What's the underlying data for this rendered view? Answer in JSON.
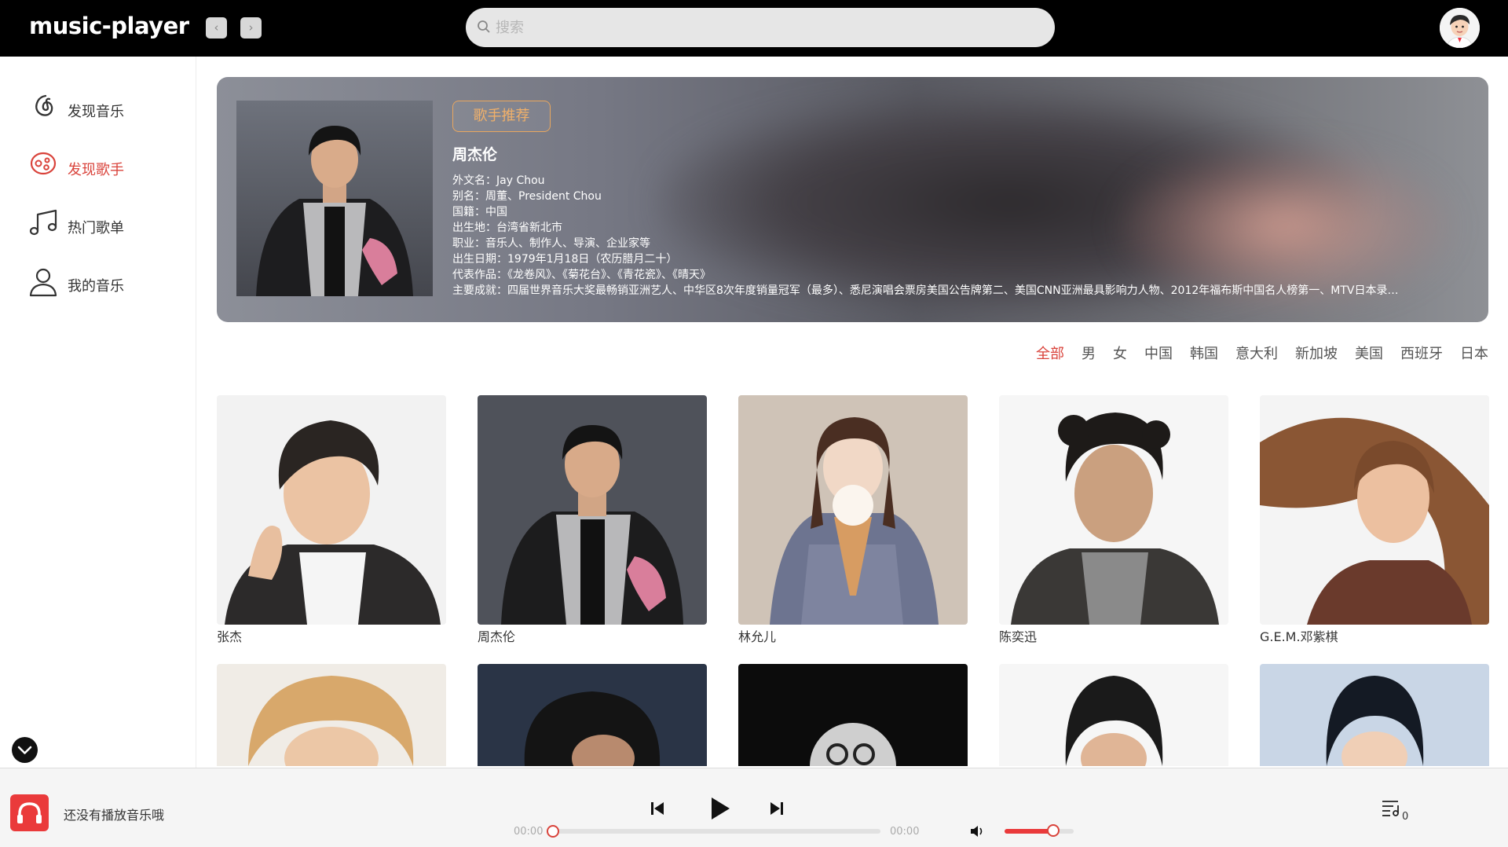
{
  "app": {
    "title": "music-player"
  },
  "header": {
    "back_icon": "chevron-left-icon",
    "forward_icon": "chevron-right-icon",
    "search_placeholder": "搜索",
    "search_value": ""
  },
  "sidebar": {
    "items": [
      {
        "label": "发现音乐",
        "icon": "netease-logo-icon",
        "active": false
      },
      {
        "label": "发现歌手",
        "icon": "vinyl-icon",
        "active": true
      },
      {
        "label": "热门歌单",
        "icon": "music-note-icon",
        "active": false
      },
      {
        "label": "我的音乐",
        "icon": "user-icon",
        "active": false
      }
    ]
  },
  "banner": {
    "tag": "歌手推荐",
    "artist": "周杰伦",
    "info": [
      "外文名：Jay Chou",
      "别名：周董、President Chou",
      "国籍：中国",
      "出生地：台湾省新北市",
      "职业：音乐人、制作人、导演、企业家等",
      "出生日期：1979年1月18日（农历腊月二十）",
      "代表作品：《龙卷风》、《菊花台》、《青花瓷》、《晴天》",
      "主要成就：四届世界音乐大奖最畅销亚洲艺人、中华区8次年度销量冠军（最多）、悉尼演唱会票房美国公告牌第二、美国CNN亚洲最具影响力人物、2012年福布斯中国名人榜第一、MTV日本录…"
    ]
  },
  "filters": {
    "items": [
      "全部",
      "男",
      "女",
      "中国",
      "韩国",
      "意大利",
      "新加坡",
      "美国",
      "西班牙",
      "日本"
    ],
    "active": "全部"
  },
  "artists": [
    {
      "name": "张杰"
    },
    {
      "name": "周杰伦"
    },
    {
      "name": "林允儿"
    },
    {
      "name": "陈奕迅"
    },
    {
      "name": "G.E.M.邓紫棋"
    }
  ],
  "player": {
    "status_text": "还没有播放音乐哦",
    "current_time": "00:00",
    "total_time": "00:00",
    "progress": 0,
    "volume": 0.7,
    "playlist_count": "0",
    "accent": "#d9433b"
  }
}
